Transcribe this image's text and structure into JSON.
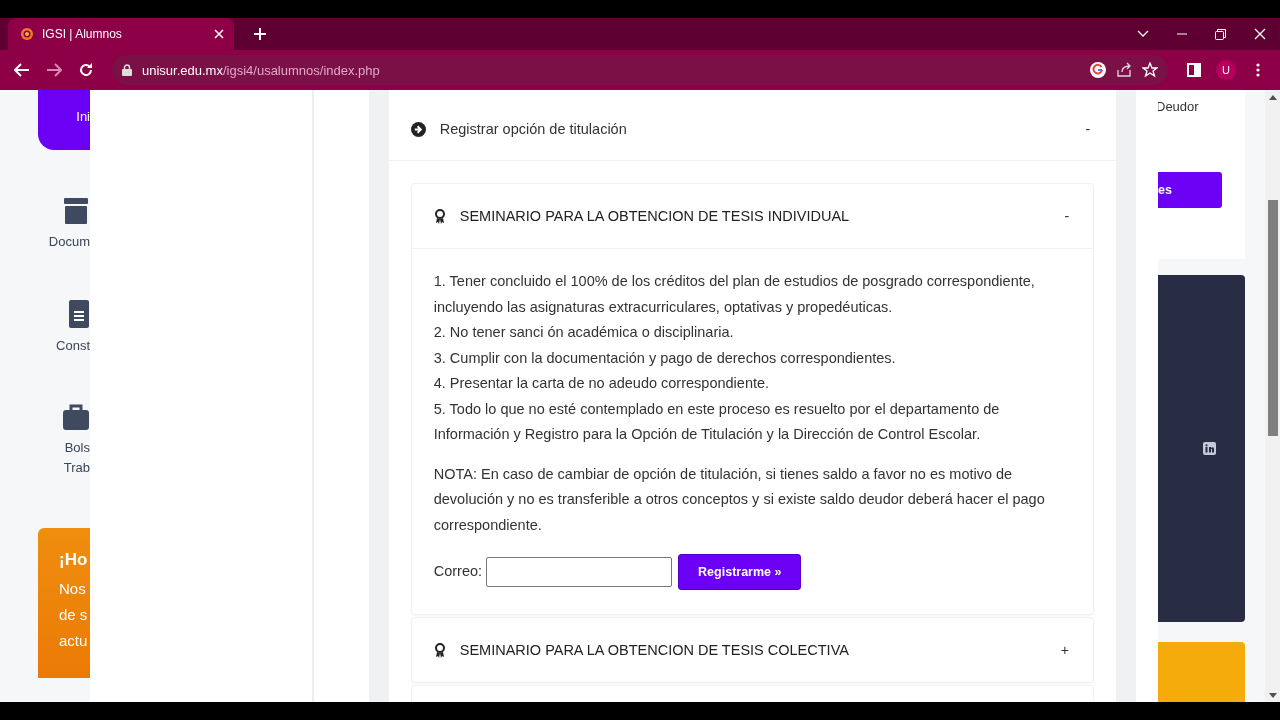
{
  "browser": {
    "tab": {
      "title": "IGSI | Alumnos",
      "selected": true
    },
    "url_host": "unisur.edu.mx",
    "url_path": "/igsi4/usalumnos/index.php",
    "profile": "U"
  },
  "background_left": {
    "nav_items": [
      {
        "label_lines": [
          "Ini"
        ],
        "selected": true
      },
      {
        "label_lines": [
          "Docum"
        ],
        "selected": false
      },
      {
        "label_lines": [
          "Const"
        ],
        "selected": false
      },
      {
        "label_lines": [
          "Bols",
          "Trab"
        ],
        "selected": false
      }
    ],
    "promo_title": "¡Ho",
    "promo_lines": [
      "Nos",
      "de s",
      "actu"
    ]
  },
  "background_right": {
    "text": "Deudor",
    "button": "es"
  },
  "modal": {
    "section_title": "Registrar opción de titulación",
    "section_toggle": "-",
    "options": [
      {
        "title": "SEMINARIO PARA LA OBTENCION DE TESIS INDIVIDUAL",
        "toggle": "-",
        "expanded": true,
        "requirements": [
          "1. Tener concluido el 100% de los créditos del plan de estudios de posgrado correspondiente, incluyendo las asignaturas extracurriculares, optativas y propedéuticas.",
          "2. No tener sanci ón académica o disciplinaria.",
          "3. Cumplir con la documentación y pago de derechos correspondientes.",
          "4. Presentar la carta de no adeudo correspondiente.",
          "5. Todo lo que no esté contemplado en este proceso es resuelto por el departamento de Información y Registro para la Opción de Titulación y la Dirección de Control Escolar."
        ],
        "note": "NOTA: En caso de cambiar de opción de titulación, si tienes saldo a favor no es motivo de devolución y no es transferible a otros conceptos y si existe saldo deudor deberá hacer el pago correspondiente.",
        "email_label": "Correo:",
        "button": "Registrarme »"
      },
      {
        "title": "SEMINARIO PARA LA OBTENCION DE TESIS COLECTIVA",
        "toggle": "+",
        "expanded": false
      }
    ]
  }
}
